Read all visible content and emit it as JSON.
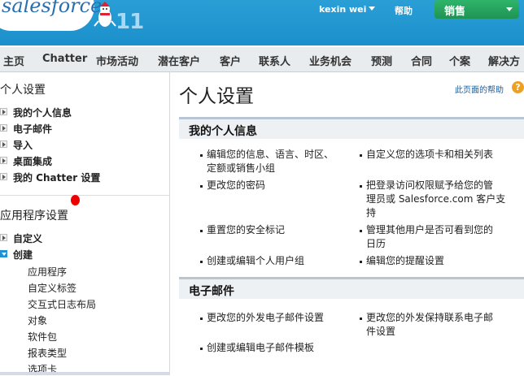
{
  "header": {
    "logo": "salesforce",
    "release": "11",
    "user_name": "kexin wei",
    "help": "帮助",
    "app_menu": "销售",
    "colors": {
      "header_bg": "#1b8fcb",
      "app_menu_bg": "#22a05c"
    }
  },
  "tabs": [
    "主页",
    "Chatter",
    "市场活动",
    "潜在客户",
    "客户",
    "联系人",
    "业务机会",
    "预测",
    "合同",
    "个案",
    "解决方"
  ],
  "sidebar": {
    "personal_title": "个人设置",
    "personal_items": [
      "我的个人信息",
      "电子邮件",
      "导入",
      "桌面集成",
      "我的 Chatter 设置"
    ],
    "app_title": "应用程序设置",
    "app_items": [
      "自定义",
      "创建"
    ],
    "create_subitems": [
      "应用程序",
      "自定义标签",
      "交互式日志布局",
      "对象",
      "软件包",
      "报表类型",
      "选项卡"
    ]
  },
  "main": {
    "title": "个人设置",
    "page_help": "此页面的帮助",
    "sections": [
      {
        "title": "我的个人信息",
        "links": [
          [
            "编辑您的信息、语言、时区、",
            "定额或销售小组"
          ],
          [
            "自定义您的选项卡和相关列表"
          ],
          [
            "更改您的密码"
          ],
          [
            "把登录访问权限赋予给您的管",
            "理员或 Salesforce.com 客户支",
            "持"
          ],
          [
            "重置您的安全标记"
          ],
          [
            "管理其他用户是否可看到您的",
            "日历"
          ],
          [
            "创建或编辑个人用户组"
          ],
          [
            "编辑您的提醒设置"
          ]
        ]
      },
      {
        "title": "电子邮件",
        "links": [
          [
            "更改您的外发电子邮件设置"
          ],
          [
            "更改您的外发保持联系电子邮",
            "件设置"
          ],
          [
            "创建或编辑电子邮件模板"
          ]
        ]
      }
    ]
  }
}
